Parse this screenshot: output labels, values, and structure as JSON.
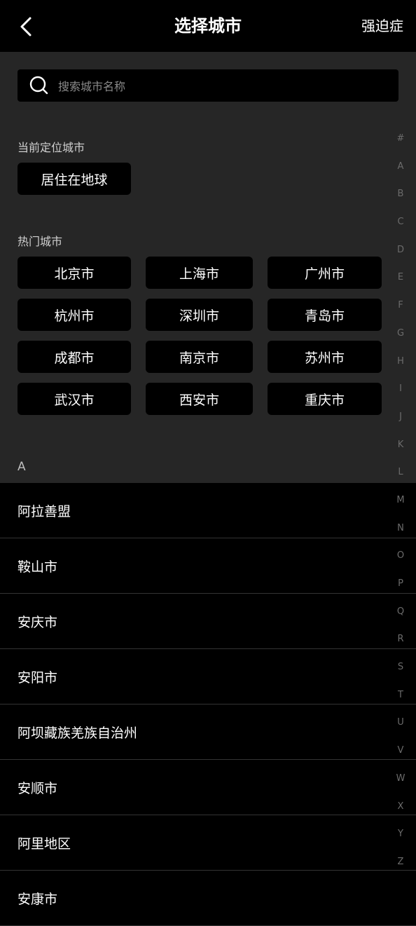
{
  "header": {
    "title": "选择城市",
    "right_action": "强迫症"
  },
  "search": {
    "placeholder": "搜索城市名称"
  },
  "current_location": {
    "label": "当前定位城市",
    "city": "居住在地球"
  },
  "hot_cities": {
    "label": "热门城市",
    "items": [
      "北京市",
      "上海市",
      "广州市",
      "杭州市",
      "深圳市",
      "青岛市",
      "成都市",
      "南京市",
      "苏州市",
      "武汉市",
      "西安市",
      "重庆市"
    ]
  },
  "list": {
    "section_letter": "A",
    "items": [
      "阿拉善盟",
      "鞍山市",
      "安庆市",
      "安阳市",
      "阿坝藏族羌族自治州",
      "安顺市",
      "阿里地区",
      "安康市"
    ]
  },
  "index_letters": [
    "#",
    "A",
    "B",
    "C",
    "D",
    "E",
    "F",
    "G",
    "H",
    "I",
    "J",
    "K",
    "L",
    "M",
    "N",
    "O",
    "P",
    "Q",
    "R",
    "S",
    "T",
    "U",
    "V",
    "W",
    "X",
    "Y",
    "Z"
  ],
  "colors": {
    "background": "#000000",
    "panel": "#262626",
    "text": "#ffffff",
    "muted": "#8a8a8a"
  }
}
